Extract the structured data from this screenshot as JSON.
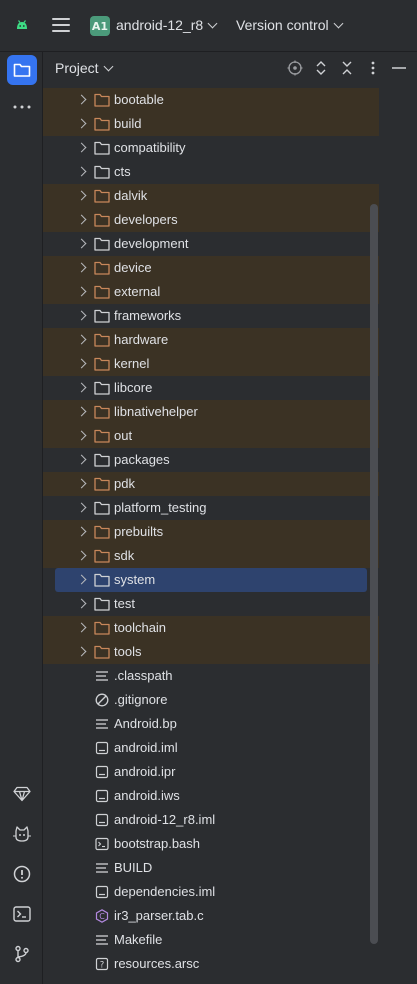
{
  "header": {
    "project_badge": "A1",
    "project_name": "android-12_r8",
    "version_control": "Version control"
  },
  "toolstrip": {
    "top": [
      "folder-icon",
      "more-icon"
    ],
    "bottom": [
      "gem-icon",
      "cat-icon",
      "problems-icon",
      "terminal-icon",
      "git-branch-icon"
    ]
  },
  "panel": {
    "title": "Project",
    "head_icons": [
      "locate-icon",
      "expand-icon",
      "collapse-icon",
      "options-icon",
      "minimize-icon"
    ]
  },
  "tree": {
    "folders": [
      {
        "name": "bootable",
        "excluded": true
      },
      {
        "name": "build",
        "excluded": true
      },
      {
        "name": "compatibility",
        "excluded": false
      },
      {
        "name": "cts",
        "excluded": false
      },
      {
        "name": "dalvik",
        "excluded": true
      },
      {
        "name": "developers",
        "excluded": true
      },
      {
        "name": "development",
        "excluded": false
      },
      {
        "name": "device",
        "excluded": true
      },
      {
        "name": "external",
        "excluded": true
      },
      {
        "name": "frameworks",
        "excluded": false
      },
      {
        "name": "hardware",
        "excluded": true
      },
      {
        "name": "kernel",
        "excluded": true
      },
      {
        "name": "libcore",
        "excluded": false
      },
      {
        "name": "libnativehelper",
        "excluded": true
      },
      {
        "name": "out",
        "excluded": true
      },
      {
        "name": "packages",
        "excluded": false
      },
      {
        "name": "pdk",
        "excluded": true
      },
      {
        "name": "platform_testing",
        "excluded": false
      },
      {
        "name": "prebuilts",
        "excluded": true
      },
      {
        "name": "sdk",
        "excluded": true
      },
      {
        "name": "system",
        "excluded": false,
        "selected": true
      },
      {
        "name": "test",
        "excluded": false
      },
      {
        "name": "toolchain",
        "excluded": true
      },
      {
        "name": "tools",
        "excluded": true
      }
    ],
    "files": [
      {
        "name": ".classpath",
        "icon": "text-lines-icon"
      },
      {
        "name": ".gitignore",
        "icon": "ignore-icon"
      },
      {
        "name": "Android.bp",
        "icon": "text-lines-icon"
      },
      {
        "name": "android.iml",
        "icon": "module-file-icon"
      },
      {
        "name": "android.ipr",
        "icon": "module-file-icon"
      },
      {
        "name": "android.iws",
        "icon": "module-file-icon"
      },
      {
        "name": "android-12_r8.iml",
        "icon": "module-file-icon"
      },
      {
        "name": "bootstrap.bash",
        "icon": "shell-script-icon"
      },
      {
        "name": "BUILD",
        "icon": "text-lines-icon"
      },
      {
        "name": "dependencies.iml",
        "icon": "module-file-icon"
      },
      {
        "name": "ir3_parser.tab.c",
        "icon": "c-file-icon"
      },
      {
        "name": "Makefile",
        "icon": "text-lines-icon"
      },
      {
        "name": "resources.arsc",
        "icon": "unknown-file-icon"
      }
    ]
  },
  "colors": {
    "background": "#2b2d30",
    "excluded_row": "#3b3224",
    "selected_row": "#2e436e",
    "accent": "#3574f0",
    "excluded_folder": "#c8875a",
    "normal_folder": "#cfd1d4"
  }
}
